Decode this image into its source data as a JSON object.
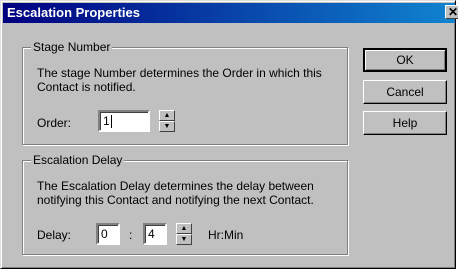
{
  "window": {
    "title": "Escalation Properties",
    "close_glyph": "✕"
  },
  "stage": {
    "legend": "Stage Number",
    "description": "The stage Number determines the Order in which this Contact is notified.",
    "order_label": "Order:",
    "order_value": "1"
  },
  "escalation": {
    "legend": "Escalation Delay",
    "description": "The Escalation Delay determines the delay between notifying this Contact and notifying the next Contact.",
    "delay_label": "Delay:",
    "hours_value": "0",
    "separator": ":",
    "minutes_value": "4",
    "units": "Hr:Min"
  },
  "buttons": {
    "ok": "OK",
    "cancel": "Cancel",
    "help": "Help"
  }
}
